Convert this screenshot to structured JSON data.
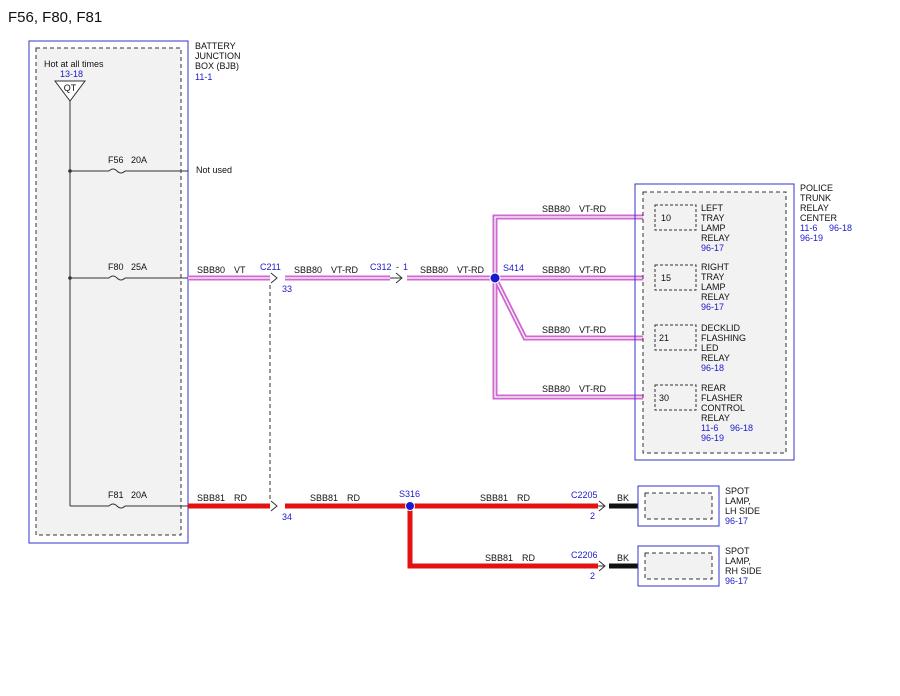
{
  "title": "F56, F80, F81",
  "bjb": {
    "name_lines": [
      "BATTERY",
      "JUNCTION",
      "BOX (BJB)"
    ],
    "ref": "11-1",
    "hot_label": "Hot at all times",
    "hot_ref": "13-18",
    "qt": "QT"
  },
  "fuses": [
    {
      "id": "F56",
      "rating": "20A"
    },
    {
      "id": "F80",
      "rating": "25A"
    },
    {
      "id": "F81",
      "rating": "20A"
    }
  ],
  "not_used": "Not used",
  "wires": {
    "w1": {
      "circuit": "SBB80",
      "color": "VT"
    },
    "w2": {
      "circuit": "SBB80",
      "color": "VT-RD"
    },
    "w3": {
      "circuit": "SBB80",
      "color": "VT-RD"
    },
    "b10": {
      "circuit": "SBB80",
      "color": "VT-RD"
    },
    "b15": {
      "circuit": "SBB80",
      "color": "VT-RD"
    },
    "b21": {
      "circuit": "SBB80",
      "color": "VT-RD"
    },
    "b30": {
      "circuit": "SBB80",
      "color": "VT-RD"
    },
    "r1": {
      "circuit": "SBB81",
      "color": "RD"
    },
    "r2": {
      "circuit": "SBB81",
      "color": "RD"
    },
    "r3": {
      "circuit": "SBB81",
      "color": "RD"
    },
    "r4": {
      "circuit": "SBB81",
      "color": "RD"
    }
  },
  "connectors": {
    "c211": {
      "name": "C211",
      "pin_a": "33",
      "pin_b": "34"
    },
    "c312": {
      "name": "C312",
      "sep": "-",
      "pin": "1"
    },
    "c2205": {
      "name": "C2205",
      "pin": "2"
    },
    "c2206": {
      "name": "C2206",
      "pin": "2"
    }
  },
  "splices": {
    "s414": "S414",
    "s316": "S316"
  },
  "relay_center": {
    "name_lines": [
      "POLICE",
      "TRUNK",
      "RELAY",
      "CENTER"
    ],
    "ref_a": "11-6",
    "ref_b": "96-18",
    "ref_c": "96-19",
    "relays": [
      {
        "pin": "10",
        "lines": [
          "LEFT",
          "TRAY",
          "LAMP",
          "RELAY"
        ],
        "refs": [
          "96-17"
        ]
      },
      {
        "pin": "15",
        "lines": [
          "RIGHT",
          "TRAY",
          "LAMP",
          "RELAY"
        ],
        "refs": [
          "96-17"
        ]
      },
      {
        "pin": "21",
        "lines": [
          "DECKLID",
          "FLASHING",
          "LED",
          "RELAY"
        ],
        "refs": [
          "96-18"
        ]
      },
      {
        "pin": "30",
        "lines": [
          "REAR",
          "FLASHER",
          "CONTROL",
          "RELAY"
        ],
        "refs": [
          "11-6",
          "96-18",
          "96-19"
        ]
      }
    ]
  },
  "lamps": [
    {
      "ground": "BK",
      "lines": [
        "SPOT",
        "LAMP,",
        "LH SIDE"
      ],
      "ref": "96-17"
    },
    {
      "ground": "BK",
      "lines": [
        "SPOT",
        "LAMP,",
        "RH SIDE"
      ],
      "ref": "96-17"
    }
  ],
  "colors": {
    "vt_rd": "#d06ad0",
    "rd": "#e31212",
    "box": "#3333cc",
    "ref_text": "#1a1acc"
  }
}
